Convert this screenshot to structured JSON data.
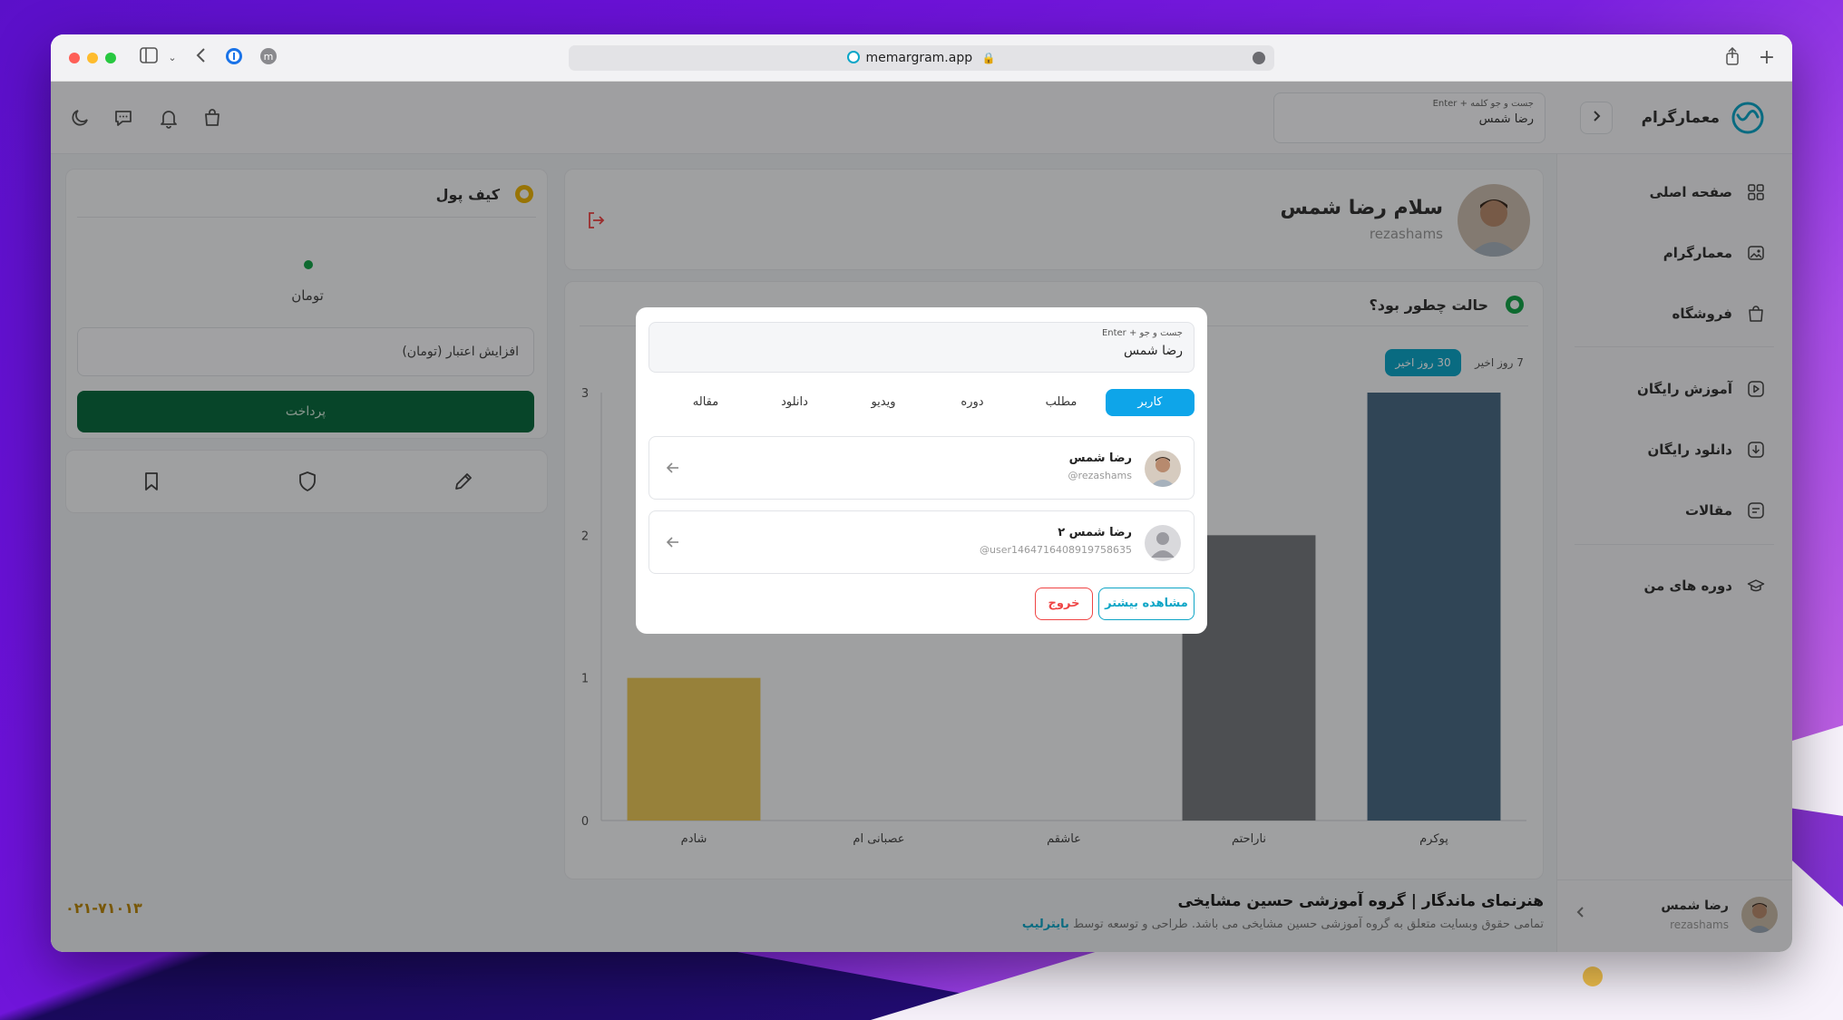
{
  "browser": {
    "url": "memargram.app"
  },
  "brand": {
    "name": "معمارگرام"
  },
  "top_search": {
    "hint": "جست و جو کلمه + Enter",
    "value": "رضا شمس"
  },
  "sidebar": {
    "items": [
      {
        "label": "صفحه اصلی",
        "icon": "grid-icon"
      },
      {
        "label": "معمارگرام",
        "icon": "image-icon"
      },
      {
        "label": "فروشگاه",
        "icon": "bag-icon"
      },
      {
        "label": "آموزش رایگان",
        "icon": "play-icon"
      },
      {
        "label": "دانلود رایگان",
        "icon": "download-icon"
      },
      {
        "label": "مقالات",
        "icon": "article-icon"
      },
      {
        "label": "دوره های من",
        "icon": "graduation-cap-icon"
      }
    ],
    "user": {
      "name": "رضا شمس",
      "username": "rezashams"
    }
  },
  "profile": {
    "greeting": "سلام رضا شمس",
    "username": "rezashams"
  },
  "mood": {
    "title": "حالت چطور بود؟",
    "range_active": "30 روز اخیر",
    "range_inactive": "7 روز اخیر"
  },
  "chart_data": {
    "type": "bar",
    "categories": [
      "پوکرم",
      "ناراحتم",
      "عاشقم",
      "عصبانی ام",
      "شادم"
    ],
    "values": [
      3,
      2,
      0,
      0,
      1
    ],
    "colors": [
      "#4a6b85",
      "#777a7e",
      "#888888",
      "#888888",
      "#e8c65a"
    ],
    "ylim": [
      0,
      3
    ],
    "yticks": [
      0,
      1,
      2,
      3
    ]
  },
  "wallet": {
    "title": "کیف پول",
    "currency": "تومان",
    "input_placeholder": "افزایش اعتبار (تومان)",
    "pay_label": "پرداخت"
  },
  "footer": {
    "title": "هنرنمای ماندگار | گروه آموزشی حسین مشایخی",
    "subtitle": "تمامی حقوق وبسایت متعلق به گروه آموزشی حسین مشایخی می باشد. طراحی و توسعه توسط",
    "link": "بایترلیپ",
    "phone": "۰۲۱-۷۱۰۱۳"
  },
  "modal": {
    "search_hint": "جست و جو + Enter",
    "search_value": "رضا شمس",
    "tabs": [
      "کاربر",
      "مطلب",
      "دوره",
      "ویدیو",
      "دانلود",
      "مقاله"
    ],
    "results": [
      {
        "name": "رضا شمس",
        "username": "rezashams@"
      },
      {
        "name": "رضا شمس ۲",
        "username": "user1464716408919758635@"
      }
    ],
    "more_label": "مشاهده بیشتر",
    "exit_label": "خروج"
  }
}
